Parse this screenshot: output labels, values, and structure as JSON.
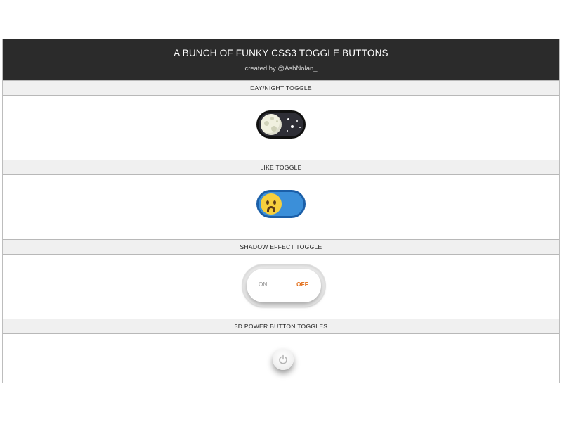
{
  "header": {
    "title": "A BUNCH OF FUNKY CSS3 TOGGLE BUTTONS",
    "subtitle": "created by @AshNolan_"
  },
  "sections": [
    {
      "label": "DAY/NIGHT TOGGLE"
    },
    {
      "label": "LIKE TOGGLE"
    },
    {
      "label": "SHADOW EFFECT TOGGLE",
      "on_text": "ON",
      "off_text": "OFF"
    },
    {
      "label": "3D POWER BUTTON TOGGLES"
    }
  ],
  "colors": {
    "header_bg": "#2b2b2b",
    "section_label_bg": "#f0f0f0",
    "night_bg": "#2e2e36",
    "moon": "#f0f0df",
    "like_bg": "#3b8fd9",
    "face": "#f6cf3d",
    "off_accent": "#e26a12"
  },
  "icons": {
    "daynight": "moon-icon",
    "like": "sad-face-icon",
    "power": "power-icon"
  }
}
